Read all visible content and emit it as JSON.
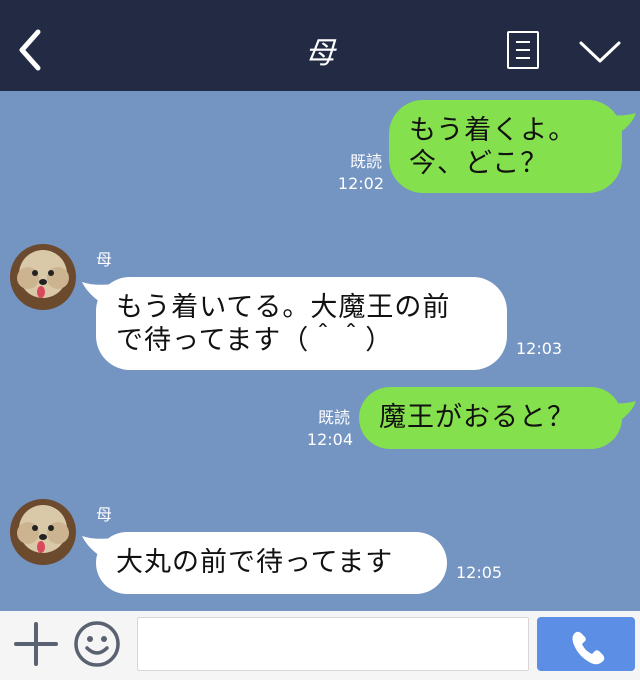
{
  "header": {
    "title": "母",
    "back_icon": "chevron-left-icon",
    "menu_icon": "notes-icon",
    "expand_icon": "chevron-down-icon"
  },
  "messages": [
    {
      "direction": "out",
      "lines": [
        "もう着くよ。",
        "今、どこ？"
      ],
      "read": "既読",
      "time": "12:02"
    },
    {
      "direction": "in",
      "sender": "母",
      "lines": [
        "もう着いてる。大魔王の前",
        "で待ってます（＾＾）"
      ],
      "time": "12:03"
    },
    {
      "direction": "out",
      "lines": [
        "魔王がおると？"
      ],
      "read": "既読",
      "time": "12:04"
    },
    {
      "direction": "in",
      "sender": "母",
      "lines": [
        "大丸の前で待ってます"
      ],
      "time": "12:05"
    }
  ],
  "input": {
    "value": "",
    "placeholder": "",
    "plus_icon": "plus-icon",
    "emoji_icon": "smiley-icon",
    "call_icon": "phone-icon"
  },
  "colors": {
    "header_bg": "#232b44",
    "chat_bg": "#7494c2",
    "outgoing_bubble": "#84e04c",
    "incoming_bubble": "#ffffff",
    "call_button": "#5c8ee6"
  }
}
